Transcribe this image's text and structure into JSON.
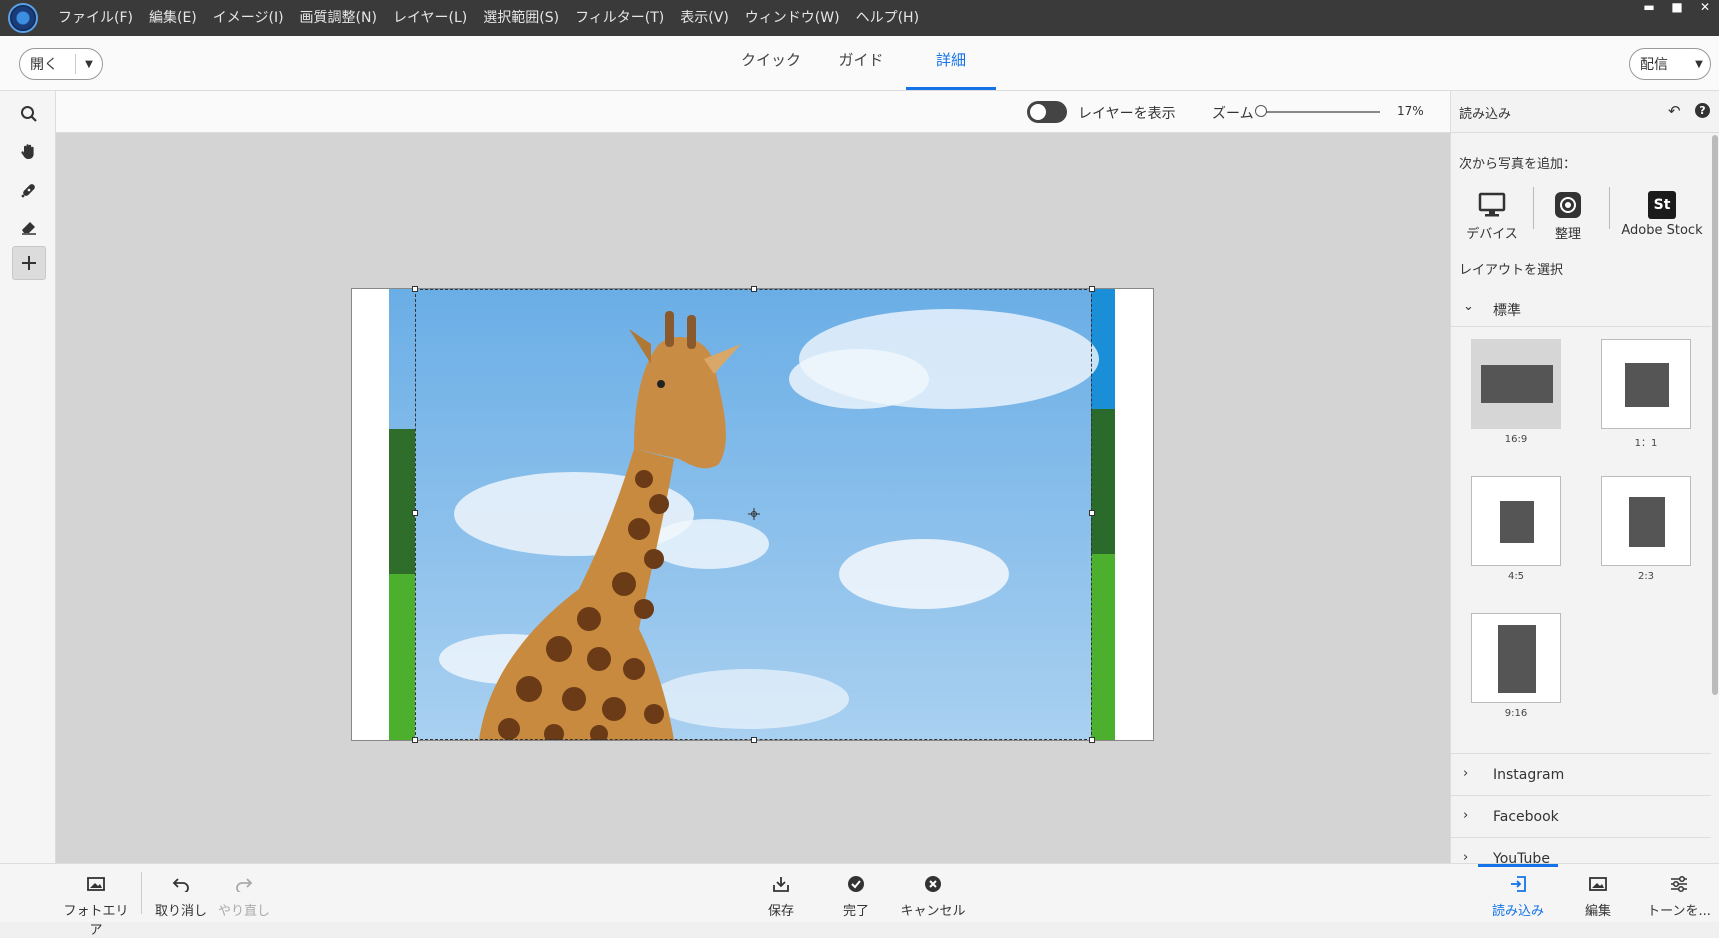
{
  "menu": {
    "items": [
      "ファイル(F)",
      "編集(E)",
      "イメージ(I)",
      "画質調整(N)",
      "レイヤー(L)",
      "選択範囲(S)",
      "フィルター(T)",
      "表示(V)",
      "ウィンドウ(W)",
      "ヘルプ(H)"
    ]
  },
  "window_controls": {
    "minimize": "▬",
    "maximize": "■",
    "close": "✕"
  },
  "topbar": {
    "open_label": "開く",
    "share_label": "配信",
    "tabs": [
      "クイック",
      "ガイド",
      "詳細"
    ],
    "active_tab": "詳細"
  },
  "options": {
    "show_layers_label": "レイヤーを表示",
    "zoom_label": "ズーム",
    "zoom_value": "17%"
  },
  "right_panel": {
    "title": "読み込み",
    "add_photos_from": "次から写真を追加：",
    "sources": [
      "デバイス",
      "整理",
      "Adobe Stock"
    ],
    "stock_icon_text": "St",
    "select_layout": "レイアウトを選択",
    "standard_section": "標準",
    "layouts": [
      "16:9",
      "1：1",
      "4:5",
      "2:3",
      "9:16"
    ],
    "collapsed_sections": [
      "Instagram",
      "Facebook",
      "YouTube"
    ]
  },
  "bottom_bar": {
    "photo_area": "フォトエリア",
    "undo": "取り消し",
    "redo": "やり直し",
    "save": "保存",
    "done": "完了",
    "cancel": "キャンセル",
    "import": "読み込み",
    "edit": "編集",
    "tone": "トーンを..."
  },
  "colors": {
    "accent": "#1473e6",
    "sky": "#7fb6e8",
    "grass": "#3f9a2e"
  }
}
